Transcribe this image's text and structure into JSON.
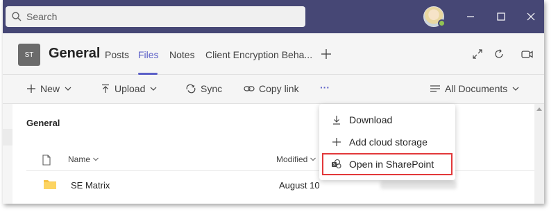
{
  "search": {
    "placeholder": "Search"
  },
  "channel": {
    "team_initials": "ST",
    "title": "General",
    "tabs": [
      {
        "label": "Posts"
      },
      {
        "label": "Files"
      },
      {
        "label": "Notes"
      },
      {
        "label": "Client Encryption Beha..."
      }
    ],
    "active_tab": "Files"
  },
  "toolbar": {
    "new_label": "New",
    "upload_label": "Upload",
    "sync_label": "Sync",
    "copy_link_label": "Copy link",
    "more_label": "···",
    "view_label": "All Documents"
  },
  "files": {
    "section_title": "General",
    "columns": {
      "name": "Name",
      "modified": "Modified"
    },
    "rows": [
      {
        "name": "SE Matrix",
        "modified": "August 10"
      }
    ]
  },
  "menu": {
    "items": [
      {
        "label": "Download",
        "icon": "download-icon"
      },
      {
        "label": "Add cloud storage",
        "icon": "plus-icon"
      },
      {
        "label": "Open in SharePoint",
        "icon": "sharepoint-icon"
      }
    ],
    "highlighted": "Open in SharePoint"
  },
  "colors": {
    "titlebar": "#464775",
    "accent": "#5b5fc7",
    "highlight_border": "#e2383a",
    "presence": "#92c353"
  }
}
